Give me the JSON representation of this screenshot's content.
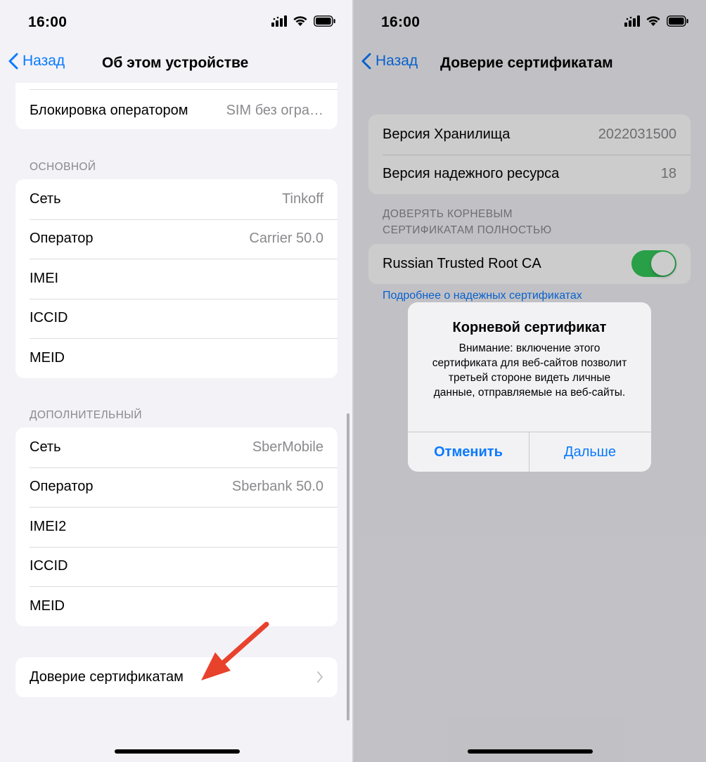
{
  "status_bar": {
    "time": "16:00"
  },
  "left": {
    "back_label": "Назад",
    "title": "Об этом устройстве",
    "top_group": {
      "label": "Блокировка оператором",
      "value": "SIM без огра…"
    },
    "primary": {
      "header": "ОСНОВНОЙ",
      "rows": [
        {
          "label": "Сеть",
          "value": "Tinkoff"
        },
        {
          "label": "Оператор",
          "value": "Carrier 50.0"
        },
        {
          "label": "IMEI",
          "value": ""
        },
        {
          "label": "ICCID",
          "value": ""
        },
        {
          "label": "MEID",
          "value": ""
        }
      ]
    },
    "secondary": {
      "header": "ДОПОЛНИТЕЛЬНЫЙ",
      "rows": [
        {
          "label": "Сеть",
          "value": "SberMobile"
        },
        {
          "label": "Оператор",
          "value": "Sberbank 50.0"
        },
        {
          "label": "IMEI2",
          "value": ""
        },
        {
          "label": "ICCID",
          "value": ""
        },
        {
          "label": "MEID",
          "value": ""
        }
      ]
    },
    "trust_row_label": "Доверие сертификатам",
    "annotation_color": "#e8412c"
  },
  "right": {
    "back_label": "Назад",
    "title": "Доверие сертификатам",
    "info_rows": [
      {
        "label": "Версия Хранилища",
        "value": "2022031500"
      },
      {
        "label": "Версия надежного ресурса",
        "value": "18"
      }
    ],
    "trust_header_line1": "ДОВЕРЯТЬ КОРНЕВЫМ",
    "trust_header_line2": "СЕРТИФИКАТАМ ПОЛНОСТЬЮ",
    "cert_name": "Russian Trusted Root CA",
    "cert_enabled": true,
    "learn_more_link": "Подробнее о надежных сертификатах",
    "alert": {
      "title": "Корневой сертификат",
      "message": "Внимание: включение этого сертификата для веб-сайтов позволит третьей стороне видеть личные данные, отправляемые на веб-сайты.",
      "cancel_label": "Отменить",
      "continue_label": "Дальше"
    }
  },
  "colors": {
    "accent": "#0a7aff",
    "toggle_on": "#34c759",
    "background": "#f2f2f7",
    "secondary_text": "#8a8a8e"
  }
}
